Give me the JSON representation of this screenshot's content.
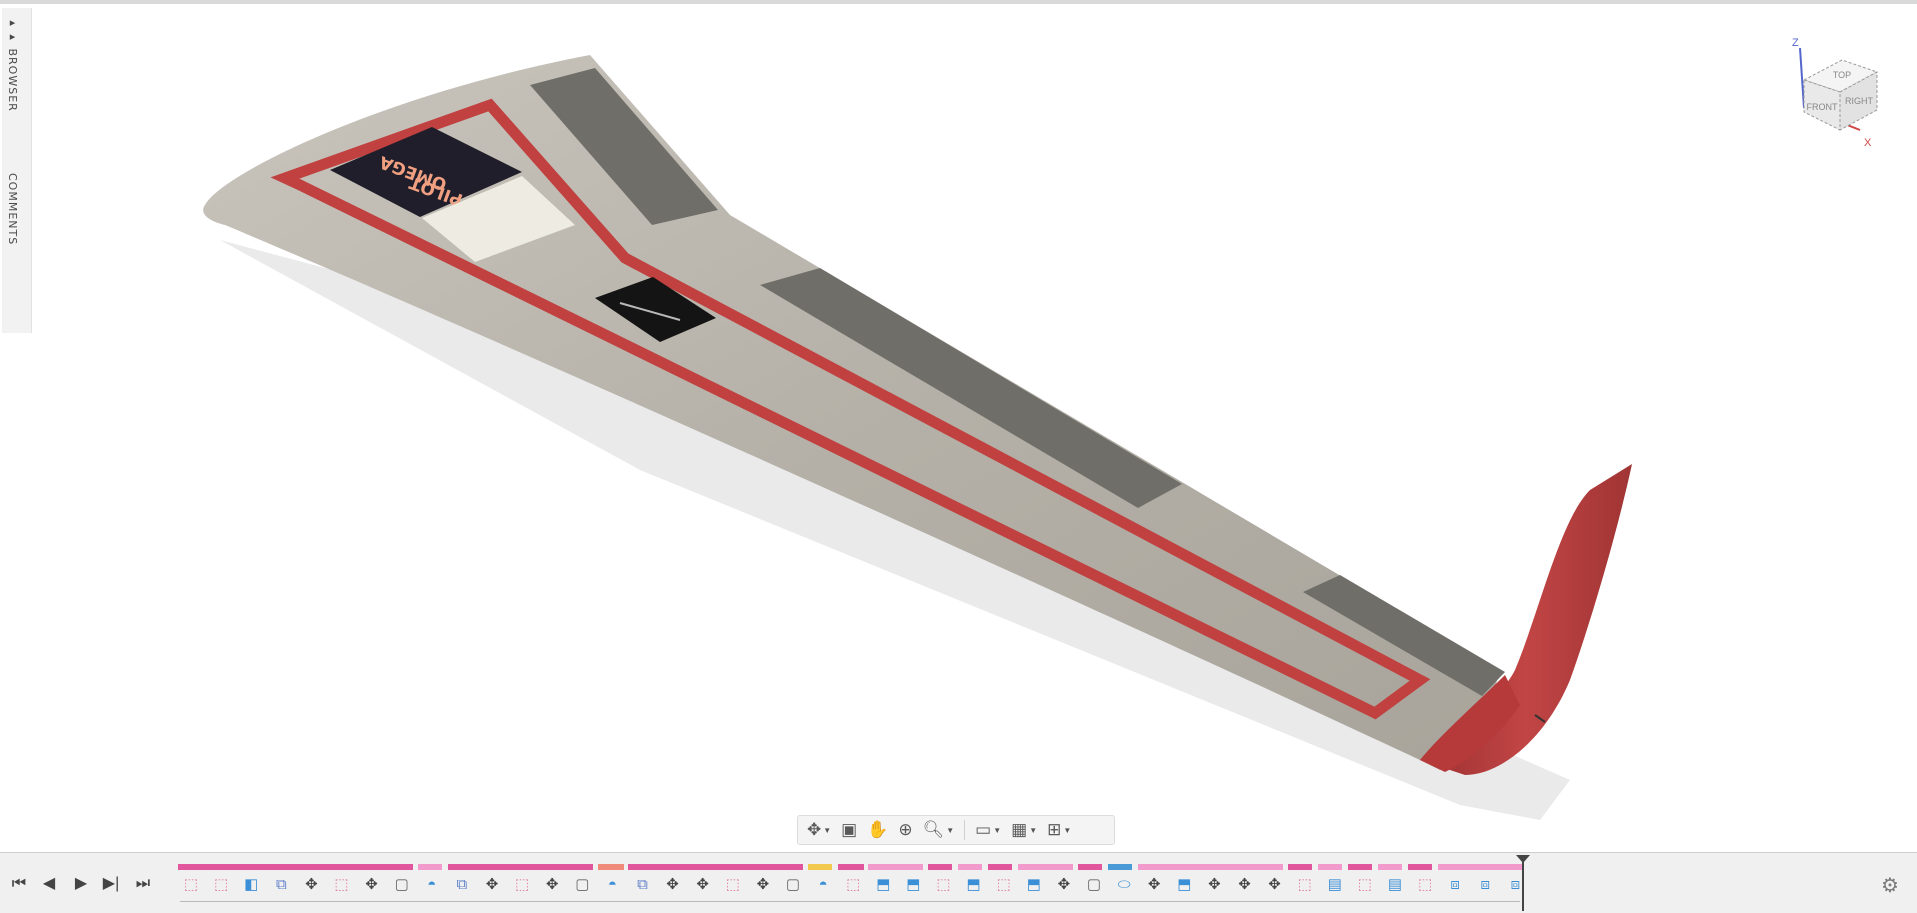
{
  "side_panel": {
    "browser_label": "▸▸ BROWSER",
    "comments_label": "COMMENTS"
  },
  "viewcube": {
    "top": "TOP",
    "front": "FRONT",
    "right": "RIGHT",
    "axis_z": "Z",
    "axis_x": "X"
  },
  "decals": {
    "big_logo_line1": "OMEGA",
    "big_logo_line2": "PILOT"
  },
  "nav_toolbar": {
    "items": [
      "orbit-icon",
      "look-at-icon",
      "pan-icon",
      "zoom-window-icon",
      "zoom-icon",
      "display-settings-icon",
      "grid-icon",
      "viewports-icon"
    ]
  },
  "timeline": {
    "controls": [
      "⏮",
      "◀",
      "▶",
      "▶|",
      "⏭"
    ],
    "features": [
      "sketch",
      "sketch",
      "extrude",
      "combine",
      "move",
      "sketch",
      "move",
      "fillet",
      "revolve",
      "combine",
      "move",
      "sketch",
      "move",
      "fillet",
      "revolve",
      "combine",
      "move",
      "move",
      "sketch",
      "move",
      "fillet",
      "revolve",
      "sketch",
      "loft",
      "loft",
      "sketch",
      "loft",
      "sketch",
      "loft",
      "move",
      "fillet",
      "cylinder",
      "move",
      "loft",
      "move",
      "move",
      "move",
      "sketch",
      "shell",
      "sketch",
      "shell",
      "sketch",
      "mirror",
      "mirror",
      "mirror"
    ],
    "colors": {
      "magenta": "#e0559c",
      "pink": "#f29acb",
      "salmon": "#f08a7a",
      "yellow": "#f2c94c",
      "blue": "#4a9ad8"
    }
  }
}
